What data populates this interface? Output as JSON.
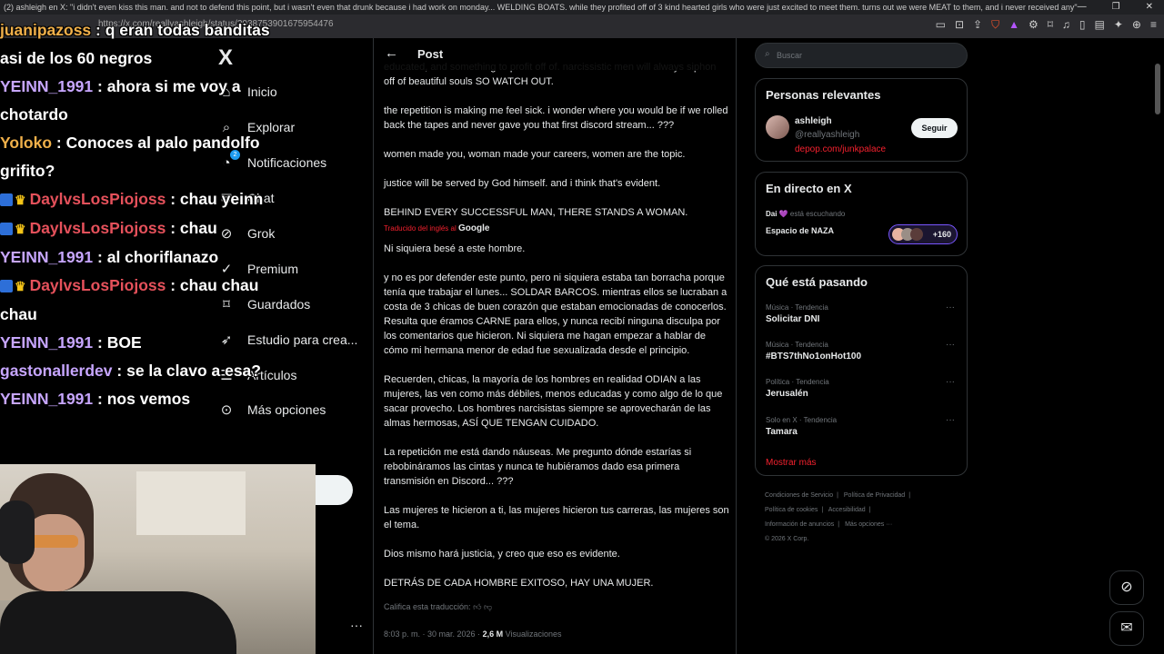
{
  "browser": {
    "title": "(2) ashleigh en X: \"i didn't even kiss this man. and not to defend this point, but i wasn't even that drunk because i had work on monday... WELDING BOATS. while they profited off of 3 kind hearted girls who were just excited to meet them. turns out we were MEAT to them, and i never received any\" / X - Brave",
    "url": "https://x.com/reallyashleigh/status/2038753901675954476",
    "window_controls": [
      "—",
      "❐",
      "✕"
    ]
  },
  "nav": {
    "logo": "X",
    "items": [
      {
        "label": "Inicio",
        "icon": "home-icon",
        "glyph": "⌂"
      },
      {
        "label": "Explorar",
        "icon": "search-icon",
        "glyph": "⌕"
      },
      {
        "label": "Notificaciones",
        "icon": "bell-icon",
        "glyph": "🔔",
        "badge": "2"
      },
      {
        "label": "Chat",
        "icon": "chat-icon",
        "glyph": "✉"
      },
      {
        "label": "Grok",
        "icon": "grok-icon",
        "glyph": "⊘"
      },
      {
        "label": "Premium",
        "icon": "premium-icon",
        "glyph": "✓"
      },
      {
        "label": "Guardados",
        "icon": "bookmark-icon",
        "glyph": "⌑"
      },
      {
        "label": "Estudio para crea...",
        "icon": "rocket-icon",
        "glyph": "➶"
      },
      {
        "label": "Artículos",
        "icon": "articles-icon",
        "glyph": "☰"
      },
      {
        "label": "Más opciones",
        "icon": "more-circle-icon",
        "glyph": "⊙"
      }
    ],
    "more_dots": "···"
  },
  "main": {
    "header_title": "Post",
    "back_icon": "←",
    "original_paragraphs": [
      "educated, and something to profit off of. narcissistic men will always siphon off of beautiful souls SO WATCH OUT.",
      "the repetition is making me feel sick. i wonder where you would be if we rolled back the tapes and never gave you that first discord stream... ???",
      "women made you, woman made your careers, women are the topic.",
      "justice will be served by God himself. and i think that's evident.",
      "BEHIND EVERY SUCCESSFUL MAN, THERE STANDS A WOMAN."
    ],
    "translated_label": "Traducido del inglés al",
    "translated_by": "Google",
    "translated_paragraphs": [
      "Ni siquiera besé a este hombre.",
      "y no es por defender este punto, pero ni siquiera estaba tan borracha porque tenía que trabajar el lunes... SOLDAR BARCOS. mientras ellos se lucraban a costa de 3 chicas de buen corazón que estaban emocionadas de conocerlos. Resulta que éramos CARNE para ellos, y nunca recibí ninguna disculpa por los comentarios que hicieron. Ni siquiera me hagan empezar a hablar de cómo mi hermana menor de edad fue sexualizada desde el principio.",
      "Recuerden, chicas, la mayoría de los hombres en realidad ODIAN a las mujeres, las ven como más débiles, menos educadas y como algo de lo que sacar provecho. Los hombres narcisistas siempre se aprovecharán de las almas hermosas, ASÍ QUE TENGAN CUIDADO.",
      "La repetición me está dando náuseas. Me pregunto dónde estarías si rebobináramos las cintas y nunca te hubiéramos dado esa primera transmisión en Discord... ???",
      "Las mujeres te hicieron a ti, las mujeres hicieron tus carreras, las mujeres son el tema.",
      "Dios mismo hará justicia, y creo que eso es evidente.",
      "DETRÁS DE CADA HOMBRE EXITOSO, HAY UNA MUJER."
    ],
    "rate_translation": "Califica esta traducción:",
    "meta_time": "8:03 p. m. · 30 mar. 2026 ·",
    "meta_views": "2,6 M",
    "meta_views_label": "Visualizaciones"
  },
  "sidebar": {
    "search_placeholder": "Buscar",
    "relevant": {
      "title": "Personas relevantes",
      "name": "ashleigh",
      "handle": "@reallyashleigh",
      "link": "depop.com/junkpalace",
      "follow_label": "Seguir"
    },
    "live": {
      "title": "En directo en X",
      "listener": "Dai 💜",
      "listening": "está escuchando",
      "space": "Espacio de NAZA",
      "count": "+160"
    },
    "trending": {
      "title": "Qué está pasando",
      "items": [
        {
          "category": "Música · Tendencia",
          "name": "Solicitar DNI"
        },
        {
          "category": "Música · Tendencia",
          "name": "#BTS7thNo1onHot100"
        },
        {
          "category": "Política · Tendencia",
          "name": "Jerusalén"
        },
        {
          "category": "Solo en X · Tendencia",
          "name": "Tamara"
        }
      ],
      "show_more": "Mostrar más"
    },
    "footer": [
      "Condiciones de Servicio",
      "|",
      "Política de Privacidad",
      "|",
      "Política de cookies",
      "|",
      "Accesibilidad",
      "|",
      "Información de anuncios",
      "|",
      "Más opciones ···",
      "© 2026 X Corp."
    ]
  },
  "stream_chat": [
    {
      "user": "juanipazoss",
      "msg": ": q eran todas banditas asi de los 60 negros",
      "color": "#f0b04a"
    },
    {
      "user": "YEINN_1991",
      "msg": ": ahora si me voy a chotardo",
      "color": "#c7a6ff"
    },
    {
      "user": "Yoloko",
      "msg": ": Conoces al palo pandolfo grifito?",
      "color": "#f0b04a"
    },
    {
      "user": "DaylvsLosPiojoss",
      "msg": ": chau yeinn",
      "color": "#e5515b"
    },
    {
      "user": "DaylvsLosPiojoss",
      "msg": ": chau",
      "color": "#e5515b"
    },
    {
      "user": "YEINN_1991",
      "msg": ": al choriflanazo",
      "color": "#c7a6ff"
    },
    {
      "user": "DaylvsLosPiojoss",
      "msg": ": chau chau chau",
      "color": "#e5515b"
    },
    {
      "user": "YEINN_1991",
      "msg": ": BOE",
      "color": "#c7a6ff"
    },
    {
      "user": "gastonallerdev",
      "msg": ": se la clavo a esa?",
      "color": "#c7a6ff"
    },
    {
      "user": "YEINN_1991",
      "msg": ": nos vemos",
      "color": "#c7a6ff"
    }
  ],
  "floating": {
    "grok_icon": "⊘",
    "messages_icon": "✉"
  }
}
